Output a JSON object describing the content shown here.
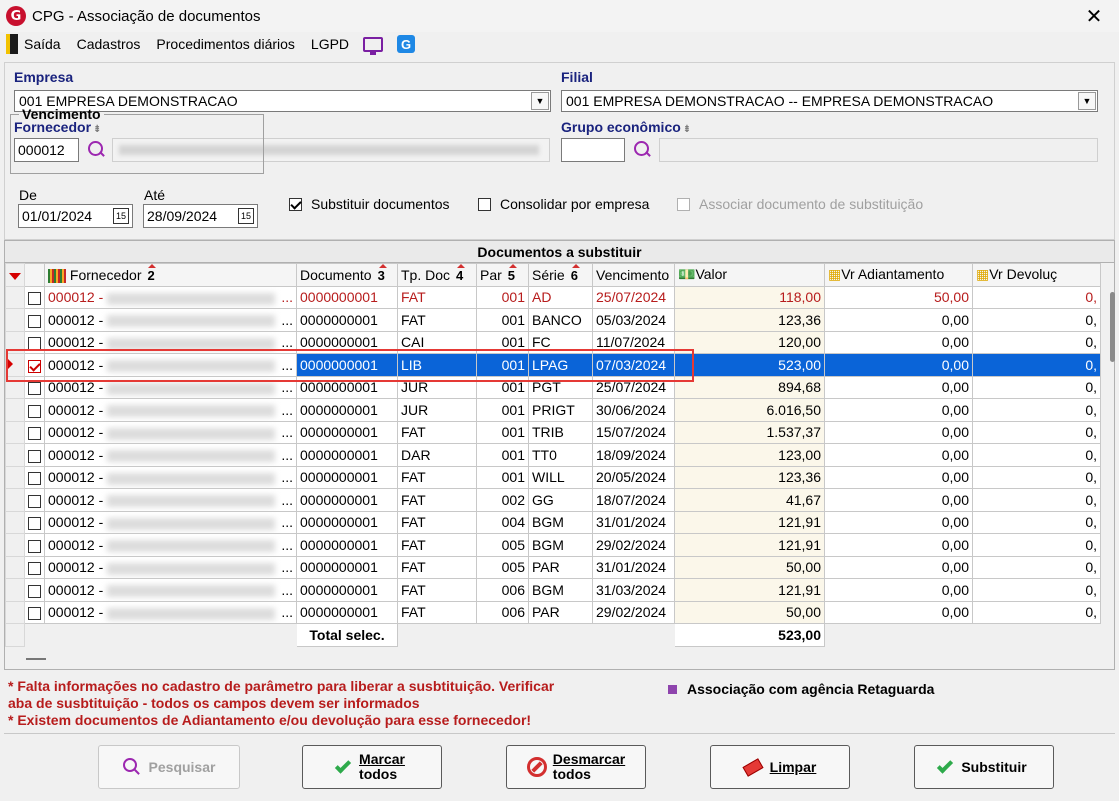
{
  "window": {
    "title": "CPG - Associação de documentos",
    "close": "✕"
  },
  "menu": [
    "Saída",
    "Cadastros",
    "Procedimentos diários",
    "LGPD"
  ],
  "filters": {
    "empresa_label": "Empresa",
    "empresa_value": "001 EMPRESA DEMONSTRACAO",
    "filial_label": "Filial",
    "filial_value": "001 EMPRESA DEMONSTRACAO -- EMPRESA DEMONSTRACAO",
    "fornecedor_label": "Fornecedor",
    "fornecedor_code": "000012",
    "grupo_label": "Grupo econômico",
    "grupo_code": "",
    "vencimento_label": "Vencimento",
    "de_label": "De",
    "de_value": "01/01/2024",
    "ate_label": "Até",
    "ate_value": "28/09/2024",
    "cal_glyph": "15",
    "chk_substituir": "Substituir documentos",
    "chk_consolidar": "Consolidar por empresa",
    "chk_associar": "Associar documento de substituição"
  },
  "grid": {
    "title": "Documentos a substituir",
    "headers": {
      "fornecedor": "Fornecedor",
      "fornecedor_sort": "2",
      "documento": "Documento",
      "documento_sort": "3",
      "tpdoc": "Tp. Doc",
      "tpdoc_sort": "4",
      "par": "Par",
      "par_sort": "5",
      "serie": "Série",
      "serie_sort": "6",
      "vencimento": "Vencimento",
      "valor": "Valor",
      "vradiant": "Vr Adiantamento",
      "vrdevol": "Vr Devoluç"
    },
    "rows": [
      {
        "code": "000012 -",
        "dots": "...",
        "doc": "0000000001",
        "tp": "FAT",
        "par": "001",
        "serie": "AD",
        "venc": "25/07/2024",
        "valor": "118,00",
        "adiant": "50,00",
        "devol": "0,",
        "checked": false,
        "style": "red"
      },
      {
        "code": "000012 -",
        "dots": "...",
        "doc": "0000000001",
        "tp": "FAT",
        "par": "001",
        "serie": "BANCO",
        "venc": "05/03/2024",
        "valor": "123,36",
        "adiant": "0,00",
        "devol": "0,",
        "checked": false,
        "style": ""
      },
      {
        "code": "000012 -",
        "dots": "...",
        "doc": "0000000001",
        "tp": "CAI",
        "par": "001",
        "serie": "FC",
        "venc": "11/07/2024",
        "valor": "120,00",
        "adiant": "0,00",
        "devol": "0,",
        "checked": false,
        "style": ""
      },
      {
        "code": "000012 -",
        "dots": "...",
        "doc": "0000000001",
        "tp": "LIB",
        "par": "001",
        "serie": "LPAG",
        "venc": "07/03/2024",
        "valor": "523,00",
        "adiant": "0,00",
        "devol": "0,",
        "checked": true,
        "style": "sel"
      },
      {
        "code": "000012 -",
        "dots": "...",
        "doc": "0000000001",
        "tp": "JUR",
        "par": "001",
        "serie": "PGT",
        "venc": "25/07/2024",
        "valor": "894,68",
        "adiant": "0,00",
        "devol": "0,",
        "checked": false,
        "style": ""
      },
      {
        "code": "000012 -",
        "dots": "...",
        "doc": "0000000001",
        "tp": "JUR",
        "par": "001",
        "serie": "PRIGT",
        "venc": "30/06/2024",
        "valor": "6.016,50",
        "adiant": "0,00",
        "devol": "0,",
        "checked": false,
        "style": ""
      },
      {
        "code": "000012 -",
        "dots": "...",
        "doc": "0000000001",
        "tp": "FAT",
        "par": "001",
        "serie": "TRIB",
        "venc": "15/07/2024",
        "valor": "1.537,37",
        "adiant": "0,00",
        "devol": "0,",
        "checked": false,
        "style": ""
      },
      {
        "code": "000012 -",
        "dots": "...",
        "doc": "0000000001",
        "tp": "DAR",
        "par": "001",
        "serie": "TT0",
        "venc": "18/09/2024",
        "valor": "123,00",
        "adiant": "0,00",
        "devol": "0,",
        "checked": false,
        "style": ""
      },
      {
        "code": "000012 -",
        "dots": "...",
        "doc": "0000000001",
        "tp": "FAT",
        "par": "001",
        "serie": "WILL",
        "venc": "20/05/2024",
        "valor": "123,36",
        "adiant": "0,00",
        "devol": "0,",
        "checked": false,
        "style": ""
      },
      {
        "code": "000012 -",
        "dots": "...",
        "doc": "0000000001",
        "tp": "FAT",
        "par": "002",
        "serie": "GG",
        "venc": "18/07/2024",
        "valor": "41,67",
        "adiant": "0,00",
        "devol": "0,",
        "checked": false,
        "style": ""
      },
      {
        "code": "000012 -",
        "dots": "...",
        "doc": "0000000001",
        "tp": "FAT",
        "par": "004",
        "serie": "BGM",
        "venc": "31/01/2024",
        "valor": "121,91",
        "adiant": "0,00",
        "devol": "0,",
        "checked": false,
        "style": ""
      },
      {
        "code": "000012 -",
        "dots": "...",
        "doc": "0000000001",
        "tp": "FAT",
        "par": "005",
        "serie": "BGM",
        "venc": "29/02/2024",
        "valor": "121,91",
        "adiant": "0,00",
        "devol": "0,",
        "checked": false,
        "style": ""
      },
      {
        "code": "000012 -",
        "dots": "...",
        "doc": "0000000001",
        "tp": "FAT",
        "par": "005",
        "serie": "PAR",
        "venc": "31/01/2024",
        "valor": "50,00",
        "adiant": "0,00",
        "devol": "0,",
        "checked": false,
        "style": ""
      },
      {
        "code": "000012 -",
        "dots": "...",
        "doc": "0000000001",
        "tp": "FAT",
        "par": "006",
        "serie": "BGM",
        "venc": "31/03/2024",
        "valor": "121,91",
        "adiant": "0,00",
        "devol": "0,",
        "checked": false,
        "style": ""
      },
      {
        "code": "000012 -",
        "dots": "...",
        "doc": "0000000001",
        "tp": "FAT",
        "par": "006",
        "serie": "PAR",
        "venc": "29/02/2024",
        "valor": "50,00",
        "adiant": "0,00",
        "devol": "0,",
        "checked": false,
        "style": ""
      }
    ],
    "total_label": "Total selec.",
    "total_value": "523,00"
  },
  "notes": {
    "line1": "* Falta informações no cadastro de parâmetro para liberar a susbtituição. Verificar",
    "line2": "aba de susbtituição - todos os campos devem ser informados",
    "line3": "* Existem documentos de Adiantamento e/ou devolução para esse fornecedor!",
    "legend": "Associação com agência Retaguarda"
  },
  "buttons": {
    "pesquisar": "Pesquisar",
    "marcar1": "Marcar",
    "marcar2": "todos",
    "desmarcar1": "Desmarcar",
    "desmarcar2": "todos",
    "limpar": "Limpar",
    "substituir": "Substituir"
  },
  "colors": {
    "selection": "#0a64d8",
    "warning": "#b71c1c",
    "label": "#1a237e"
  }
}
